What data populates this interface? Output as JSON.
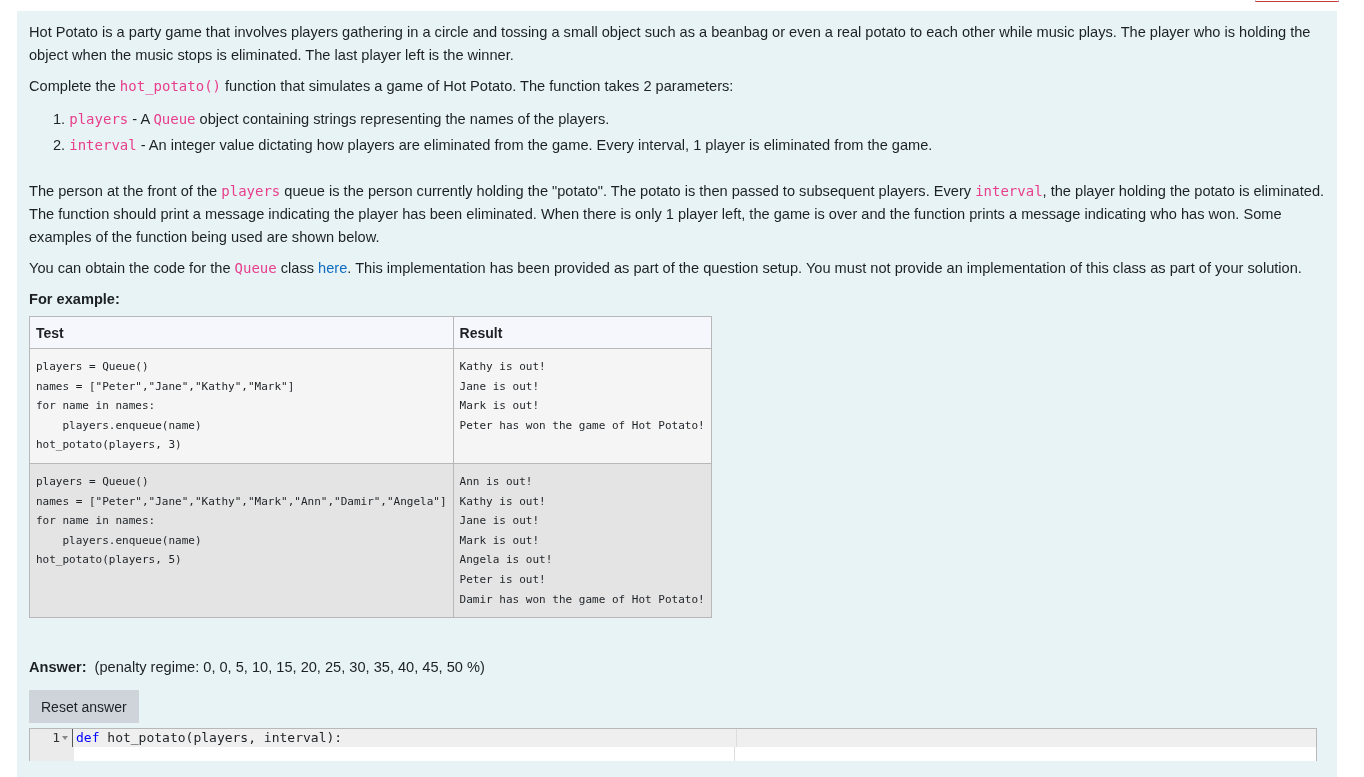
{
  "intro": [
    {
      "kind": "text",
      "text": "Hot Potato is a party game that involves players gathering in a circle and tossing a small object such as a beanbag or even a real potato to each other while music plays. The player who is holding the object when the music stops is eliminated. The last player left is the winner."
    }
  ],
  "task": [
    {
      "kind": "text",
      "text": "Complete the "
    },
    {
      "kind": "code",
      "text": "hot_potato()"
    },
    {
      "kind": "text",
      "text": " function that simulates a game of Hot Potato. The function takes 2 parameters:"
    }
  ],
  "parameters": [
    {
      "marker": "1.",
      "parts": [
        {
          "kind": "code",
          "text": "players"
        },
        {
          "kind": "text",
          "text": " - A "
        },
        {
          "kind": "code",
          "text": "Queue"
        },
        {
          "kind": "text",
          "text": " object containing strings representing the names of the players."
        }
      ]
    },
    {
      "marker": "2.",
      "parts": [
        {
          "kind": "code",
          "text": "interval"
        },
        {
          "kind": "text",
          "text": " - An integer value dictating how players are eliminated from the game. Every interval, 1 player is eliminated from the game."
        }
      ]
    }
  ],
  "rules": [
    {
      "kind": "text",
      "text": "The person at the front of the "
    },
    {
      "kind": "code",
      "text": "players"
    },
    {
      "kind": "text",
      "text": " queue is the person currently holding the \"potato\". The potato is then passed to subsequent players. Every "
    },
    {
      "kind": "code",
      "text": "interval"
    },
    {
      "kind": "text",
      "text": ", the player holding the potato is eliminated. The function should print a message indicating the player has been eliminated. When there is only 1 player left, the game is over and the function prints a message indicating who has won. Some examples of the function being used are shown below."
    }
  ],
  "queue_note": [
    {
      "kind": "text",
      "text": "You can obtain the code for the "
    },
    {
      "kind": "code",
      "text": "Queue"
    },
    {
      "kind": "text",
      "text": " class "
    },
    {
      "kind": "link",
      "text": "here"
    },
    {
      "kind": "text",
      "text": ". This implementation has been provided as part of the question setup. You must not provide an implementation of this class as part of your solution."
    }
  ],
  "example_heading": "For example:",
  "table": {
    "columns": [
      "Test",
      "Result"
    ],
    "rows": [
      {
        "test": [
          "players = Queue()",
          "names = [\"Peter\",\"Jane\",\"Kathy\",\"Mark\"]",
          "for name in names:",
          "    players.enqueue(name)",
          "hot_potato(players, 3)"
        ],
        "result": [
          "Kathy is out!",
          "Jane is out!",
          "Mark is out!",
          "Peter has won the game of Hot Potato!"
        ]
      },
      {
        "test": [
          "players = Queue()",
          "names = [\"Peter\",\"Jane\",\"Kathy\",\"Mark\",\"Ann\",\"Damir\",\"Angela\"]",
          "for name in names:",
          "    players.enqueue(name)",
          "hot_potato(players, 5)"
        ],
        "result": [
          "Ann is out!",
          "Kathy is out!",
          "Jane is out!",
          "Mark is out!",
          "Angela is out!",
          "Peter is out!",
          "Damir has won the game of Hot Potato!"
        ]
      }
    ]
  },
  "answer": {
    "label": "Answer:",
    "penalty": "(penalty regime: 0, 0, 5, 10, 15, 20, 25, 30, 35, 40, 45, 50 %)",
    "reset_button": "Reset answer"
  },
  "editor": {
    "lines": [
      {
        "number": "1",
        "foldable": true,
        "keyword": "def",
        "rest": " hot_potato(players, interval):"
      }
    ]
  }
}
